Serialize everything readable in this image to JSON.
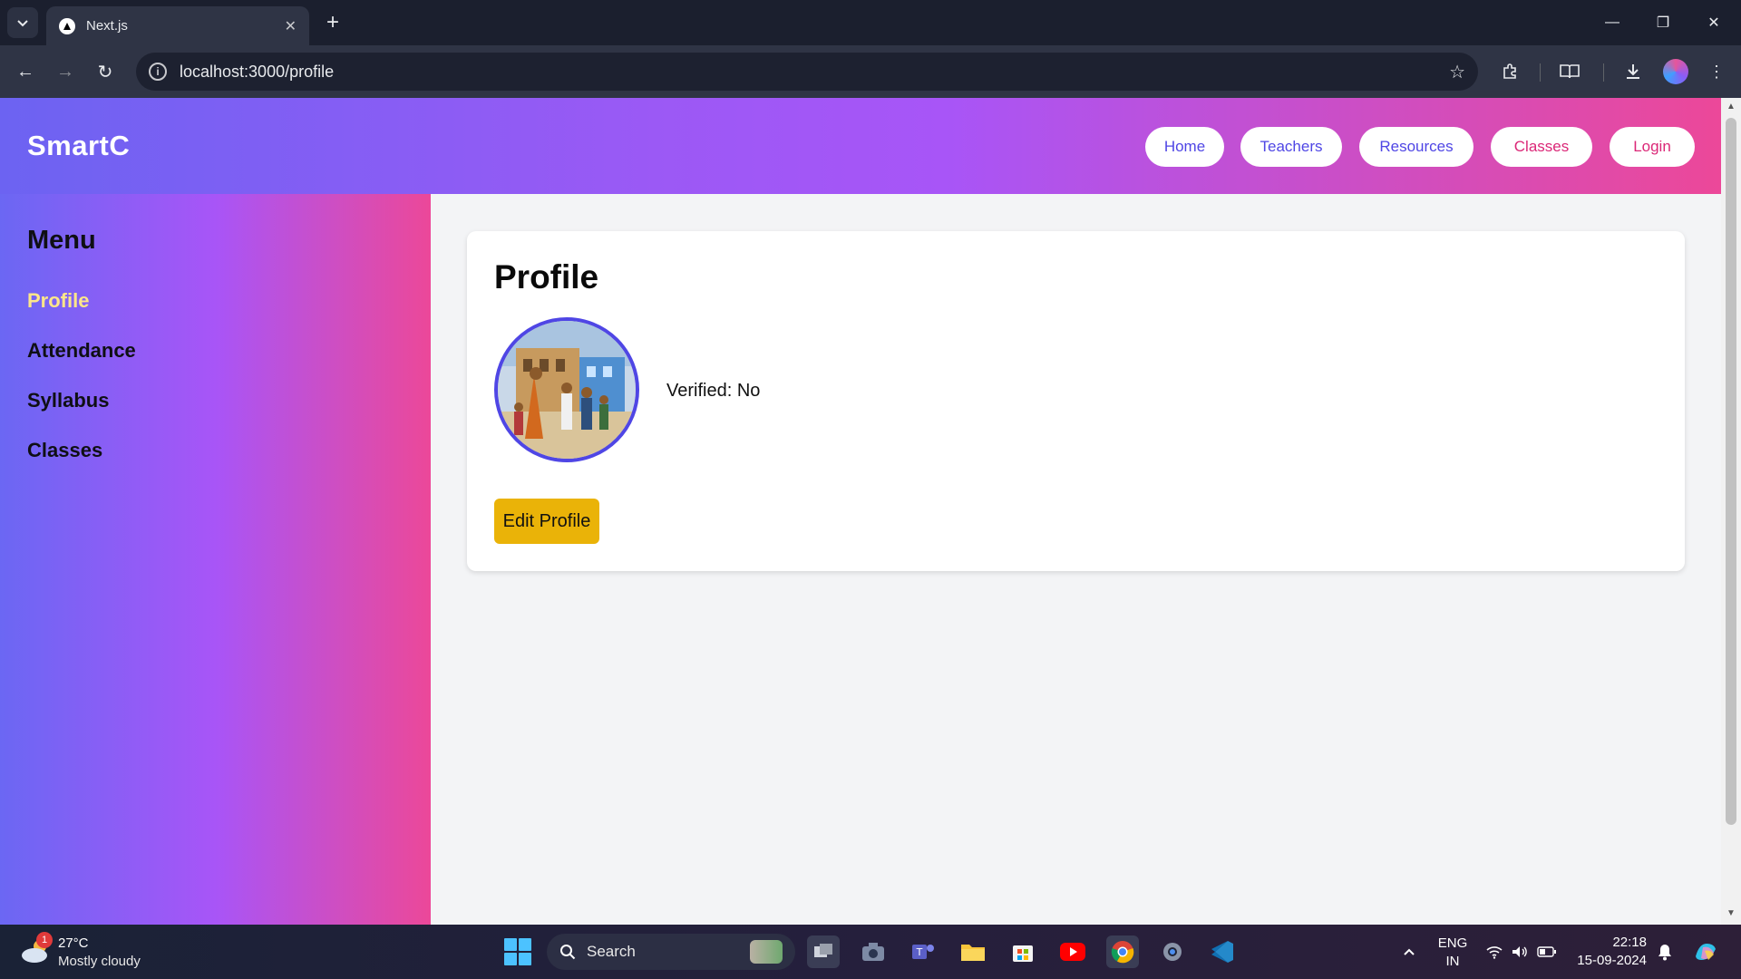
{
  "browser": {
    "tab_title": "Next.js",
    "url": "localhost:3000/profile",
    "icons": {
      "tab_search": "chevron-down-icon",
      "tab_close": "close-icon",
      "new_tab": "plus-icon",
      "back": "back-arrow-icon",
      "forward": "forward-arrow-icon",
      "reload": "reload-icon",
      "site_info": "info-icon",
      "bookmark": "star-icon",
      "extensions": "puzzle-icon",
      "reading_mode": "book-icon",
      "downloads": "download-icon",
      "menu": "kebab-menu-icon"
    }
  },
  "header": {
    "brand": "SmartC",
    "nav": [
      {
        "label": "Home",
        "color": "#4f46e5"
      },
      {
        "label": "Teachers",
        "color": "#4f46e5"
      },
      {
        "label": "Resources",
        "color": "#4f46e5"
      },
      {
        "label": "Classes",
        "color": "#db2777"
      },
      {
        "label": "Login",
        "color": "#db2777"
      }
    ],
    "gradient": [
      "#6c63f2",
      "#a855f7",
      "#ec4899"
    ]
  },
  "sidebar": {
    "title": "Menu",
    "items": [
      {
        "label": "Profile",
        "active": true
      },
      {
        "label": "Attendance",
        "active": false
      },
      {
        "label": "Syllabus",
        "active": false
      },
      {
        "label": "Classes",
        "active": false
      }
    ],
    "active_color": "#fde68a"
  },
  "profile": {
    "title": "Profile",
    "verified_text": "Verified: No",
    "edit_label": "Edit Profile",
    "avatar_border": "#4f46e5",
    "edit_color": "#eab308"
  },
  "taskbar": {
    "weather": {
      "badge": "1",
      "temp": "27°C",
      "desc": "Mostly cloudy"
    },
    "search_label": "Search",
    "lang_top": "ENG",
    "lang_bottom": "IN",
    "time": "22:18",
    "date": "15-09-2024"
  }
}
